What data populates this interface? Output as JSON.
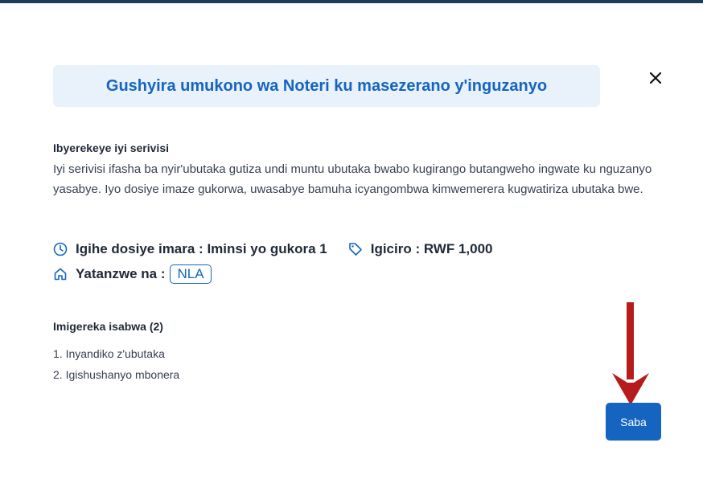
{
  "modal": {
    "title": "Gushyira umukono wa Noteri ku masezerano y'inguzanyo",
    "close_icon": "close-icon"
  },
  "about": {
    "heading": "Ibyerekeye iyi serivisi",
    "description": "Iyi serivisi ifasha ba nyir'ubutaka gutiza undi muntu ubutaka bwabo kugirango butangweho ingwate ku nguzanyo yasabye. Iyo dosiye imaze gukorwa, uwasabye bamuha icyangombwa kimwemerera kugwatiriza ubutaka bwe."
  },
  "meta": {
    "processing_time": "Igihe dosiye imara : Iminsi yo gukora 1",
    "price": "Igiciro : RWF 1,000",
    "provider_label": "Yatanzwe na :",
    "provider_value": "NLA",
    "clock_icon": "clock-icon",
    "tag_icon": "tag-icon",
    "home_icon": "home-icon"
  },
  "requirements": {
    "heading": "Imigereka isabwa (2)",
    "items": [
      "1. Inyandiko z'ubutaka",
      "2. Igishushanyo mbonera"
    ]
  },
  "actions": {
    "next_label": "Saba",
    "accent": "#1565c0",
    "annotation_arrow_color": "#b71c1c"
  }
}
